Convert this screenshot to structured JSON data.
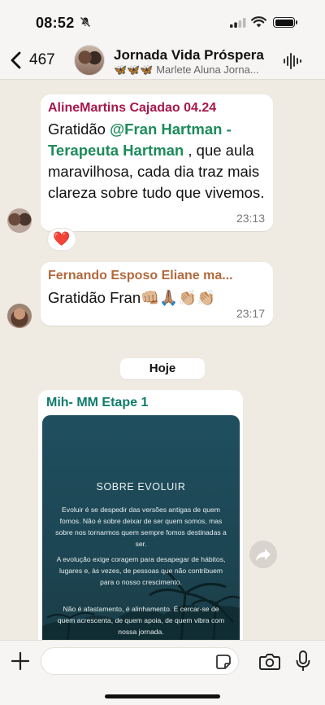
{
  "status_bar": {
    "time": "08:52"
  },
  "header": {
    "back_count": "467",
    "title": "Jornada Vida Próspera",
    "subtitle_emoji": "🦋🦋🦋",
    "subtitle_text": "Marlete Aluna Jorna..."
  },
  "messages": [
    {
      "sender": "AlineMartins Cajadao 04.24",
      "text_before": "Gratidão ",
      "mention": "@Fran Hartman - Terapeuta  Hartman",
      "text_after": " , que aula maravilhosa, cada dia traz mais clareza sobre tudo que vivemos.",
      "time": "23:13",
      "reaction": "❤️"
    },
    {
      "sender": "Fernando Esposo Eliane ma...",
      "text": "Gratidão Fran👊🏼🙏🏽👏🏼👏🏼",
      "time": "23:17"
    }
  ],
  "day_divider": "Hoje",
  "image_message": {
    "sender": "Mih- MM Etape 1",
    "image_title": "SOBRE EVOLUIR",
    "paragraphs": [
      "Evoluir é se despedir das versões antigas de quem fomos. Não é sobre deixar de ser quem somos, mas sobre nos tornarmos quem sempre fomos destinadas a ser.",
      "A evolução exige coragem para desapegar de hábitos, lugares e, às vezes, de pessoas que não contribuem para o nosso crescimento.",
      "Não é afastamento, é alinhamento. É cercar-se de quem acrescenta, de quem apoia, de quem vibra com nossa jornada."
    ]
  },
  "colors": {
    "sender1": "#a8174a",
    "mention": "#1c8b5a",
    "sender2": "#b26a3d",
    "sender3": "#0f7a6a",
    "chat_background": "#efeae2"
  }
}
